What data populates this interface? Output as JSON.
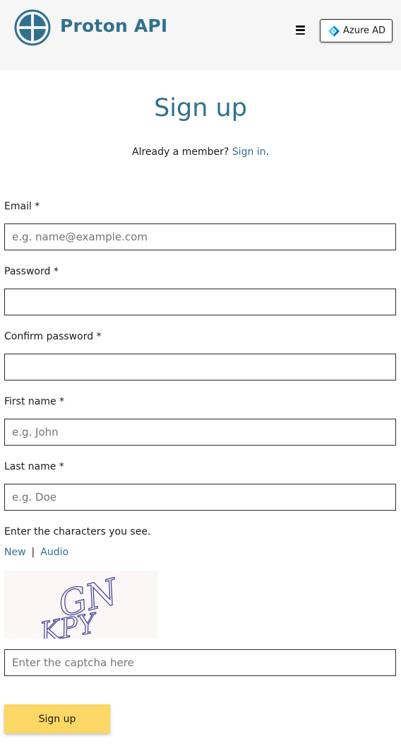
{
  "header": {
    "brand": "Proton API",
    "menu_icon": "hamburger-menu-icon",
    "logo_icon": "proton-globe-logo-icon",
    "azure": {
      "icon": "azure-diamond-icon",
      "label": "Azure AD"
    }
  },
  "page": {
    "title": "Sign up",
    "member_prompt": "Already a member?",
    "sign_in_link": "Sign in",
    "member_suffix": "."
  },
  "form": {
    "email": {
      "label": "Email *",
      "placeholder": "e.g. name@example.com",
      "value": ""
    },
    "password": {
      "label": "Password *",
      "placeholder": "",
      "value": ""
    },
    "confirm_password": {
      "label": "Confirm password *",
      "placeholder": "",
      "value": ""
    },
    "first_name": {
      "label": "First name *",
      "placeholder": "e.g. John",
      "value": ""
    },
    "last_name": {
      "label": "Last name *",
      "placeholder": "e.g. Doe",
      "value": ""
    },
    "captcha": {
      "prompt": "Enter the characters you see.",
      "new_link": "New",
      "separator": "|",
      "audio_link": "Audio",
      "image_text": "GNKPY",
      "placeholder": "Enter the captcha here",
      "value": ""
    },
    "submit_label": "Sign up"
  },
  "colors": {
    "brand": "#31708f",
    "header_bg": "#f6f6f6",
    "button_yellow": "#fbd866",
    "azure_light": "#50c8f0",
    "azure_dark": "#0089d6"
  }
}
